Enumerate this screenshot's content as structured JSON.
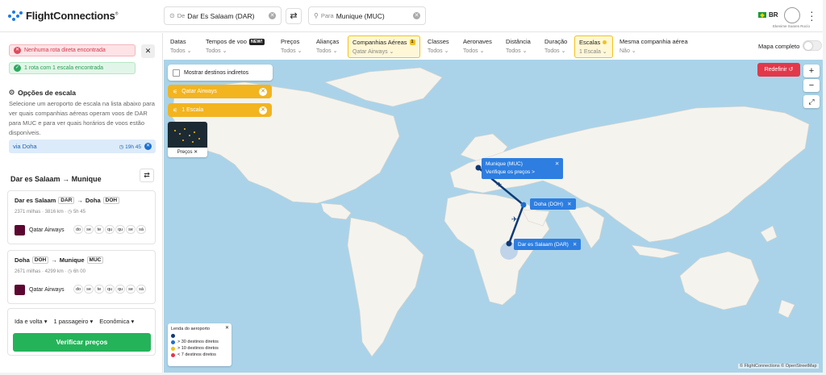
{
  "header": {
    "logo": "FlightConnections",
    "logo_mark": "®",
    "from_prefix": "De",
    "from_value": "Dar Es Salaam (DAR)",
    "to_prefix": "Para",
    "to_value": "Munique (MUC)",
    "lang": "BR",
    "user_name": "Ekenime Soares Rocío"
  },
  "alerts": {
    "no_direct": "Nenhuma rota direta encontrada",
    "one_stop": "1 rota com 1 escala encontrada"
  },
  "stopover": {
    "title": "Opções de escala",
    "description": "Selecione um aeroporto de escala na lista abaixo para ver quais companhias aéreas operam voos de DAR para MUC e para ver quais horários de voos estão disponíveis.",
    "via": "via Doha",
    "via_duration": "19h 45"
  },
  "route": {
    "from": "Dar es Salaam",
    "to": "Munique",
    "arrow": "→"
  },
  "legs": [
    {
      "from": "Dar es Salaam",
      "from_code": "DAR",
      "to": "Doha",
      "to_code": "DOH",
      "distance": "2371 milhas · 3816 km",
      "duration": "5h 45",
      "airline": "Qatar Airways"
    },
    {
      "from": "Doha",
      "from_code": "DOH",
      "to": "Munique",
      "to_code": "MUC",
      "distance": "2671 milhas · 4299 km",
      "duration": "6h 00",
      "airline": "Qatar Airways"
    }
  ],
  "days": [
    "do",
    "se",
    "te",
    "qu",
    "qu",
    "se",
    "sá"
  ],
  "booking": {
    "trip": "Ida e volta",
    "passengers": "1 passageiro",
    "cabin": "Econômica",
    "verify": "Verificar preços"
  },
  "filters": [
    {
      "title": "Datas",
      "value": "Todos"
    },
    {
      "title": "Tempos de voo",
      "value": "Todos",
      "badge": "NEW!"
    },
    {
      "title": "Preços",
      "value": "Todos"
    },
    {
      "title": "Alianças",
      "value": "Todos"
    },
    {
      "title": "Companhias Aéreas",
      "value": "Qatar Airways",
      "count": "1"
    },
    {
      "title": "Classes",
      "value": "Todos"
    },
    {
      "title": "Aeronaves",
      "value": "Todos"
    },
    {
      "title": "Distância",
      "value": "Todos"
    },
    {
      "title": "Duração",
      "value": "Todos"
    },
    {
      "title": "Escalas",
      "value": "1 Escala"
    },
    {
      "title": "Mesma companhia aérea",
      "value": "Não"
    }
  ],
  "map_toggle": "Mapa completo",
  "map": {
    "show_indirect": "Mostrar destinos indiretos",
    "chip_airline": "Qatar Airways",
    "chip_stops": "1 Escala",
    "prices_label": "Preços",
    "redefine": "Redefinir",
    "muc_label": "Munique (MUC)",
    "muc_sub": "Verifique os preços >",
    "doh_label": "Doha (DOH)",
    "dar_label": "Dar es Salaam (DAR)",
    "legend_title": "Lenda do aeroporto",
    "legend": [
      "> 30 destinos diretos",
      "> 10 destinos diretos",
      "< 7 destinos diretos"
    ],
    "attribution": "© FlightConnections © OpenStreetMap"
  },
  "colors": {
    "accent": "#2d7ee0",
    "verify": "#25b35a",
    "redefine": "#e2384a",
    "highlight": "#f2c21b",
    "route": "#0f3a76"
  }
}
